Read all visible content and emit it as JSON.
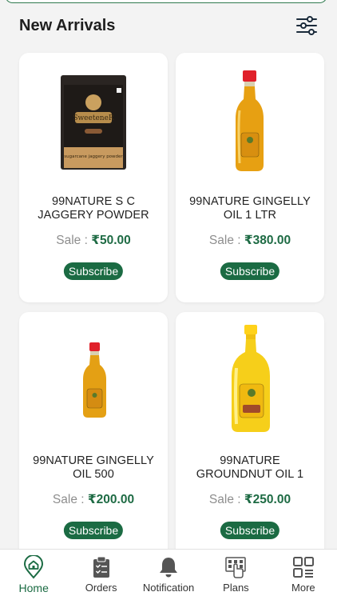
{
  "header": {
    "title": "New Arrivals"
  },
  "products": [
    {
      "name": "99NATURE S C JAGGERY POWDER",
      "price_label": "Sale :",
      "price": "₹50.00",
      "button": "Subscribe"
    },
    {
      "name": "99NATURE GINGELLY OIL 1 LTR",
      "price_label": "Sale :",
      "price": "₹380.00",
      "button": "Subscribe"
    },
    {
      "name": "99NATURE GINGELLY OIL 500",
      "price_label": "Sale :",
      "price": "₹200.00",
      "button": "Subscribe"
    },
    {
      "name": "99NATURE GROUNDNUT OIL 1",
      "price_label": "Sale :",
      "price": "₹250.00",
      "button": "Subscribe"
    }
  ],
  "package_text": {
    "brand": "SweeteneR",
    "desc": "sugarcane jaggery powder"
  },
  "bottom_nav": [
    {
      "label": "Home",
      "icon": "home-icon",
      "active": true
    },
    {
      "label": "Orders",
      "icon": "clipboard-icon",
      "active": false
    },
    {
      "label": "Notification",
      "icon": "bell-icon",
      "active": false
    },
    {
      "label": "Plans",
      "icon": "plans-icon",
      "active": false
    },
    {
      "label": "More",
      "icon": "grid-icon",
      "active": false
    }
  ],
  "colors": {
    "accent": "#1b6b43",
    "price": "#1e6b44",
    "background": "#f3f3f3"
  }
}
